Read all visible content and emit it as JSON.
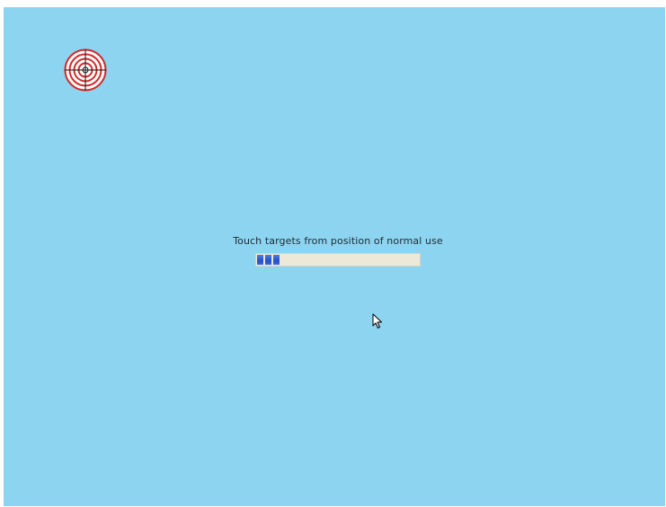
{
  "calibration": {
    "prompt_text": "Touch targets from position of normal use",
    "progress": {
      "fraction": 0.15
    }
  },
  "colors": {
    "background": "#8dd4f1",
    "target_red": "#d42a2a",
    "progress_track": "#ece9d8",
    "progress_fill": "#2f5fd0"
  },
  "icons": {
    "target": "crosshair-target-icon",
    "cursor": "mouse-pointer-icon"
  }
}
